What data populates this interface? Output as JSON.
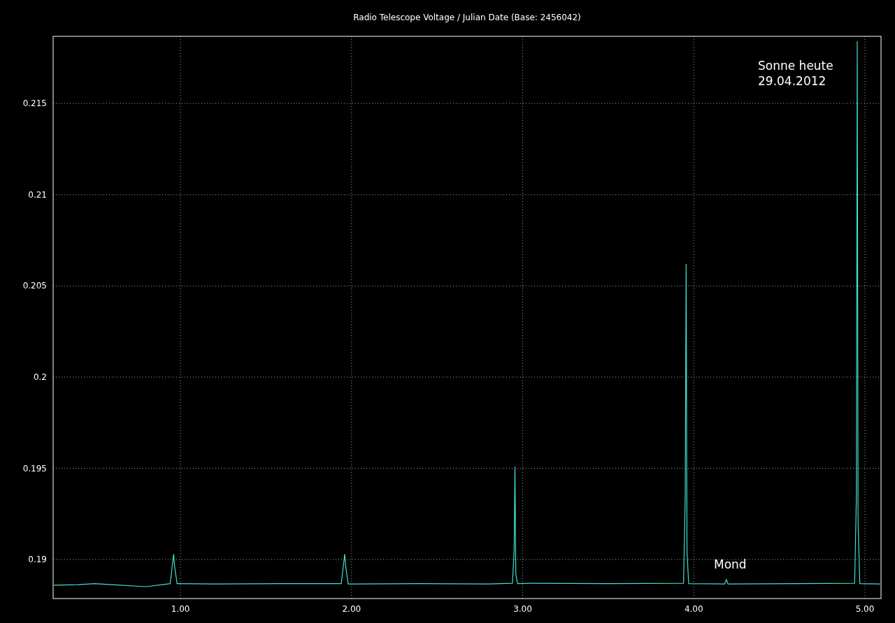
{
  "chart_data": {
    "type": "line",
    "title": "Radio Telescope Voltage / Julian Date (Base: 2456042)",
    "xlim": [
      0.256,
      5.094
    ],
    "ylim": [
      0.18786,
      0.21868
    ],
    "xticks": [
      {
        "value": 1,
        "label": "1.00"
      },
      {
        "value": 2,
        "label": "2.00"
      },
      {
        "value": 3,
        "label": "3.00"
      },
      {
        "value": 4,
        "label": "4.00"
      },
      {
        "value": 5,
        "label": "5.00"
      }
    ],
    "yticks": [
      {
        "value": 0.19,
        "label": "0.19"
      },
      {
        "value": 0.195,
        "label": "0.195"
      },
      {
        "value": 0.2,
        "label": "0.2"
      },
      {
        "value": 0.205,
        "label": "0.205"
      },
      {
        "value": 0.21,
        "label": "0.21"
      },
      {
        "value": 0.215,
        "label": "0.215"
      }
    ],
    "x": [
      0.26,
      0.4,
      0.5,
      0.6,
      0.8,
      0.94,
      0.955,
      0.96,
      0.965,
      0.98,
      1.2,
      1.6,
      1.94,
      1.955,
      1.96,
      1.965,
      1.98,
      2.4,
      2.8,
      2.94,
      2.95,
      2.955,
      2.96,
      2.97,
      3.05,
      3.5,
      3.94,
      3.95,
      3.955,
      3.96,
      3.97,
      4.18,
      4.19,
      4.2,
      4.6,
      4.94,
      4.95,
      4.955,
      4.96,
      4.97,
      5.09
    ],
    "series": [
      {
        "color": "#40e0d0",
        "values": [
          0.18859,
          0.18862,
          0.18868,
          0.18862,
          0.18851,
          0.18868,
          0.1899,
          0.1903,
          0.1897,
          0.18868,
          0.18866,
          0.18868,
          0.18868,
          0.1899,
          0.1903,
          0.1897,
          0.18866,
          0.18868,
          0.18866,
          0.1887,
          0.1905,
          0.1951,
          0.1892,
          0.18868,
          0.1887,
          0.18868,
          0.1887,
          0.1935,
          0.2062,
          0.1905,
          0.18868,
          0.18866,
          0.1889,
          0.18866,
          0.18868,
          0.1887,
          0.1935,
          0.2184,
          0.192,
          0.18868,
          0.18866
        ]
      }
    ],
    "grid": true,
    "annotations": [
      "Sonne heute",
      "29.04.2012",
      "Mond"
    ]
  }
}
